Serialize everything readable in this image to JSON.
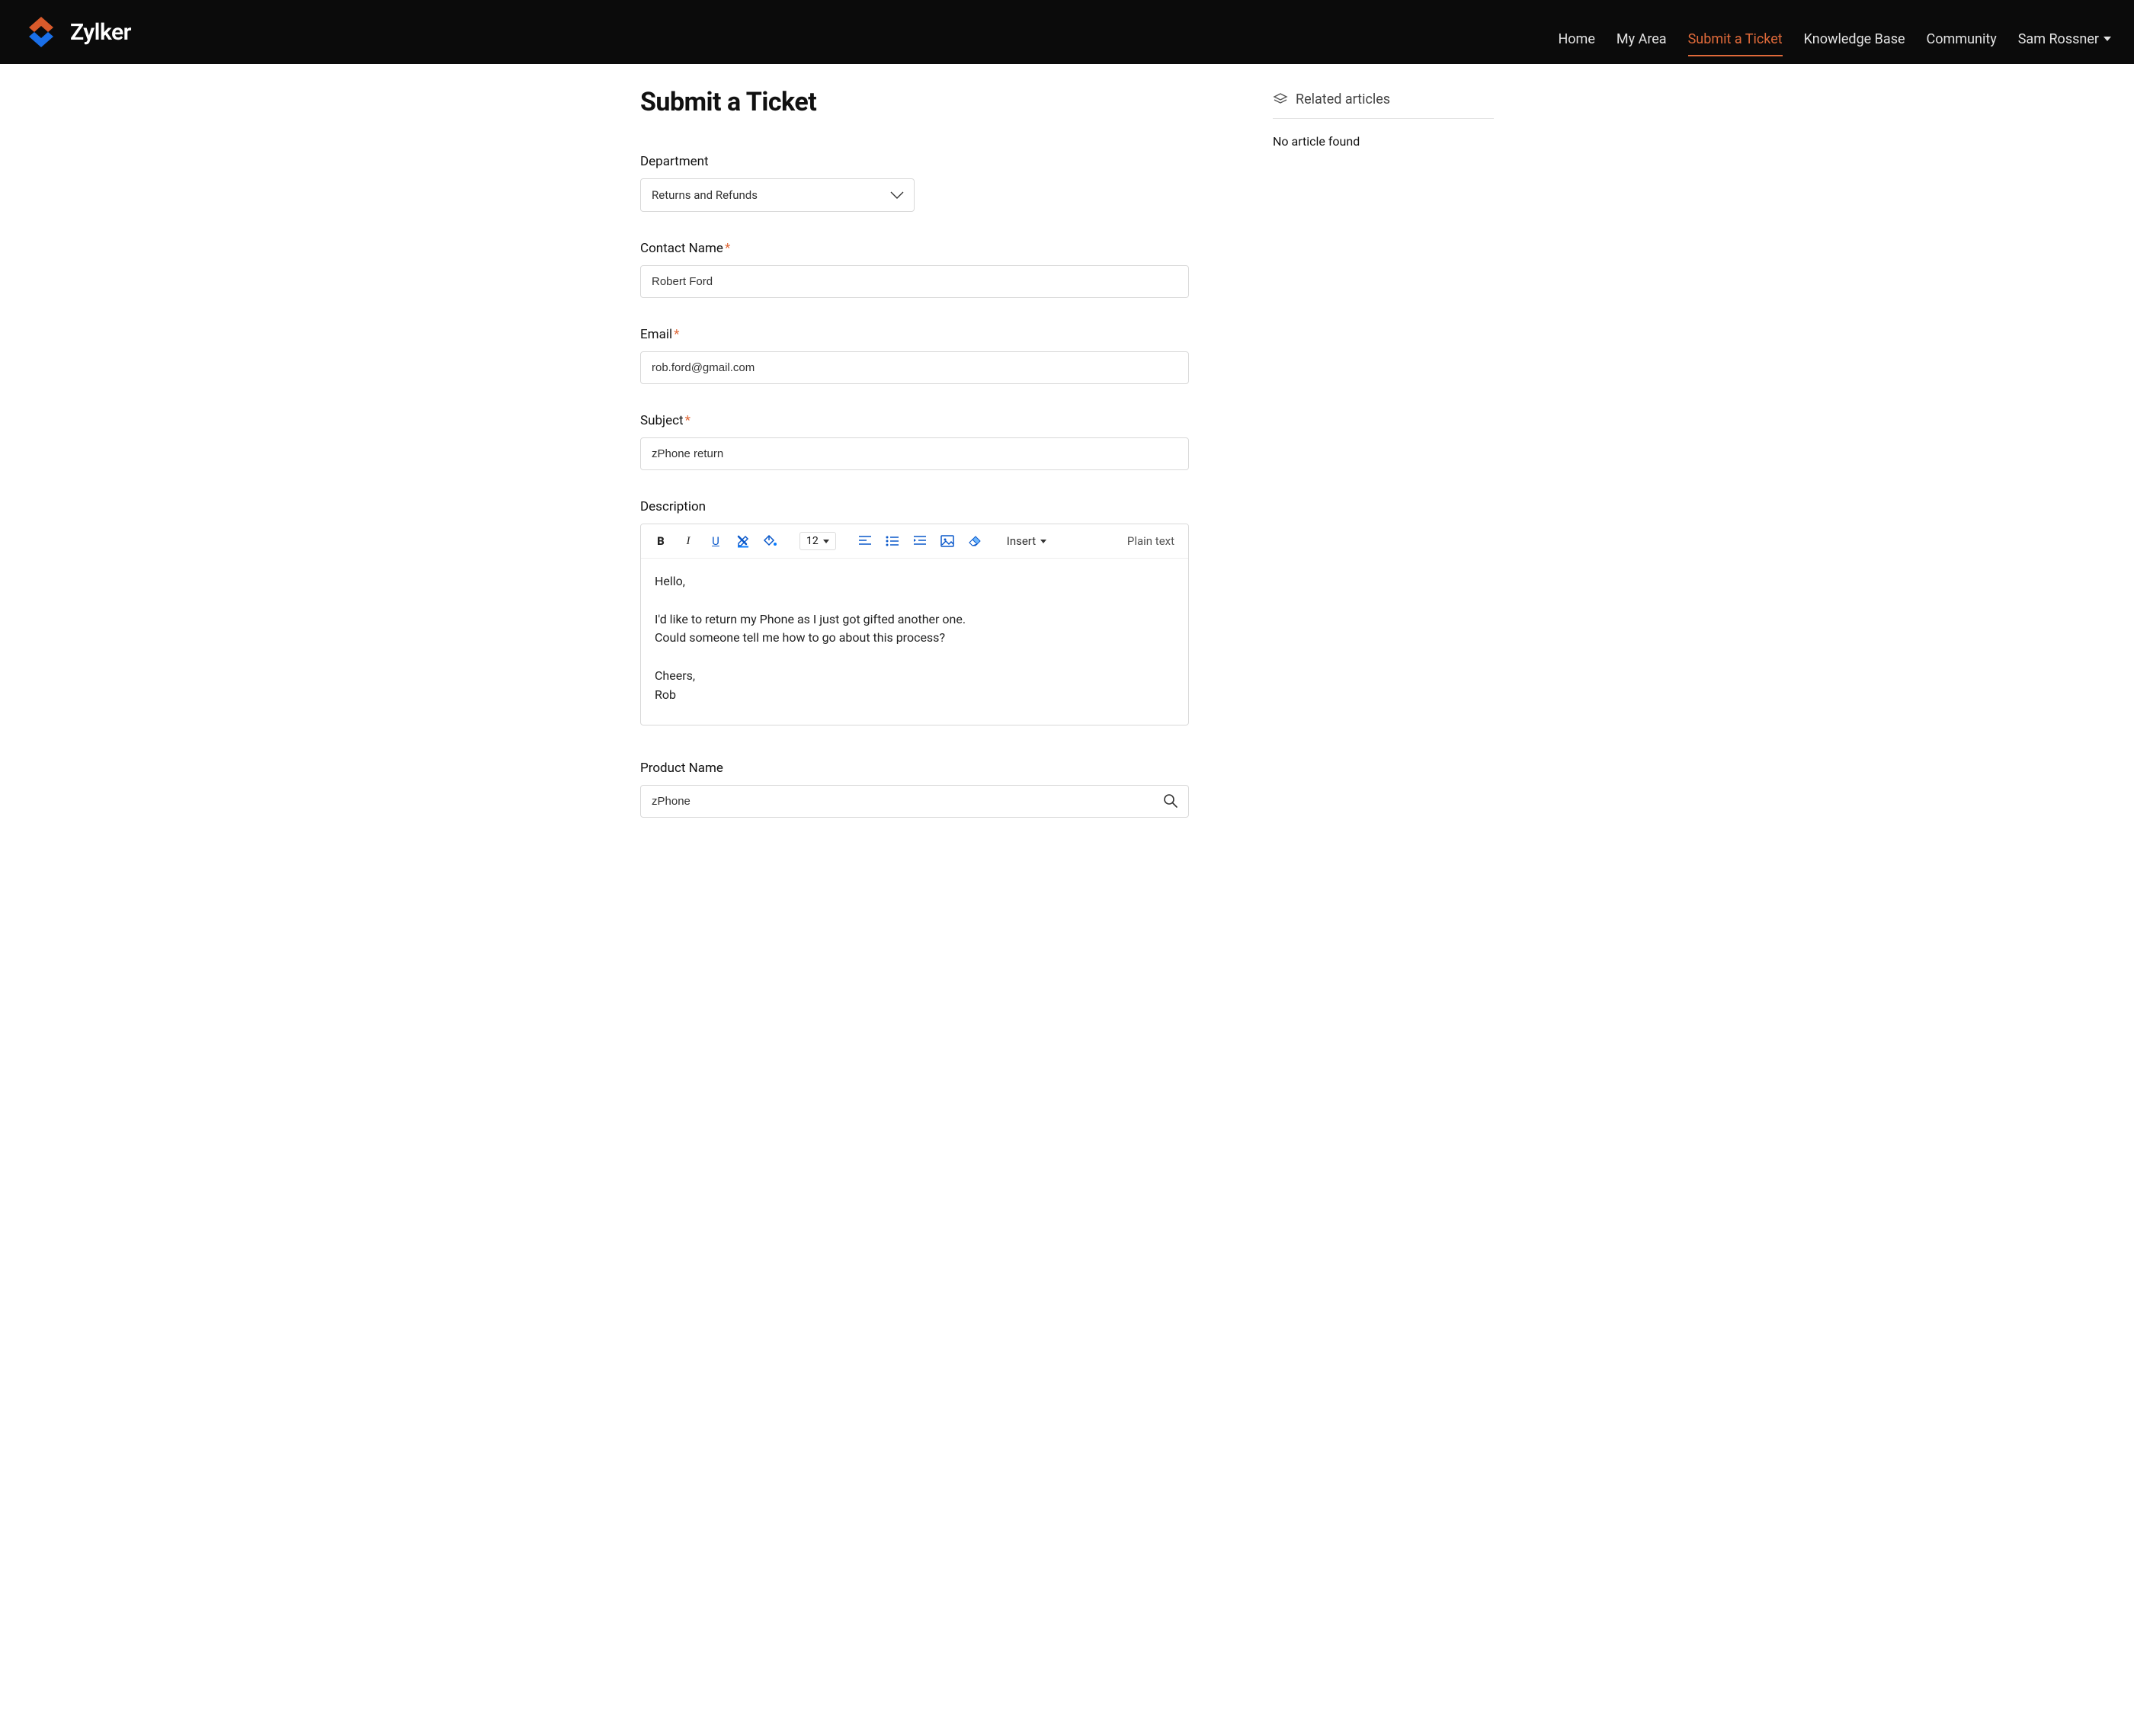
{
  "brand": {
    "name": "Zylker"
  },
  "nav": {
    "items": [
      {
        "label": "Home",
        "active": false
      },
      {
        "label": "My Area",
        "active": false
      },
      {
        "label": "Submit a Ticket",
        "active": true
      },
      {
        "label": "Knowledge Base",
        "active": false
      },
      {
        "label": "Community",
        "active": false
      }
    ],
    "user_label": "Sam Rossner"
  },
  "page": {
    "title": "Submit a Ticket"
  },
  "form": {
    "department": {
      "label": "Department",
      "value": "Returns and Refunds"
    },
    "contact_name": {
      "label": "Contact Name",
      "required": true,
      "value": "Robert Ford"
    },
    "email": {
      "label": "Email",
      "required": true,
      "value": "rob.ford@gmail.com"
    },
    "subject": {
      "label": "Subject",
      "required": true,
      "value": "zPhone return"
    },
    "description": {
      "label": "Description",
      "font_size": "12",
      "insert_label": "Insert",
      "plain_text_label": "Plain text",
      "body": "Hello,\n\nI'd like to return my Phone as I just got gifted another one.\nCould someone tell me how to go about this process?\n\nCheers,\nRob"
    },
    "product": {
      "label": "Product Name",
      "value": "zPhone"
    }
  },
  "sidebar": {
    "title": "Related articles",
    "empty_text": "No article found"
  }
}
